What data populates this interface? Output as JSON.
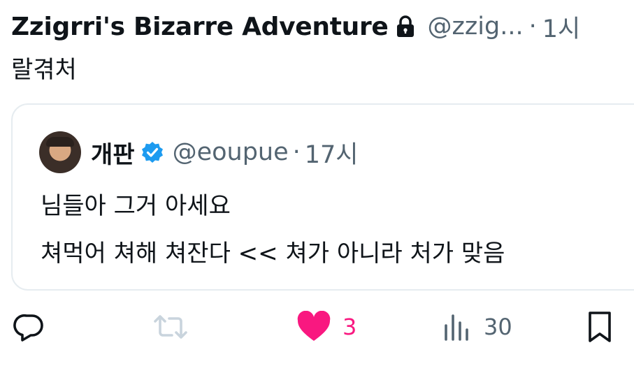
{
  "tweet": {
    "display_name": "Zzigrri's Bizarre Adventure",
    "handle": "@zzig...",
    "separator": "·",
    "time": "1시",
    "text": "랄겪처",
    "locked_icon": "lock-icon"
  },
  "quote": {
    "name": "개판",
    "verified_icon": "verified-badge-icon",
    "handle": "@eoupue",
    "separator": "·",
    "time": "17시",
    "lines": [
      "님들아 그거 아세요",
      "쳐먹어 쳐해 쳐잔다 << 쳐가 아니라 처가 맞음"
    ]
  },
  "actions": {
    "reply_icon": "reply-icon",
    "retweet_icon": "retweet-icon",
    "like_icon": "heart-icon",
    "like_count": "3",
    "views_icon": "views-chart-icon",
    "views_count": "30",
    "bookmark_icon": "bookmark-icon"
  },
  "colors": {
    "text": "#0f1419",
    "secondary": "#536471",
    "like": "#f91880",
    "verified": "#1d9bf0",
    "retweet_inactive": "#c9d4dd",
    "border": "#e6ecf0"
  }
}
